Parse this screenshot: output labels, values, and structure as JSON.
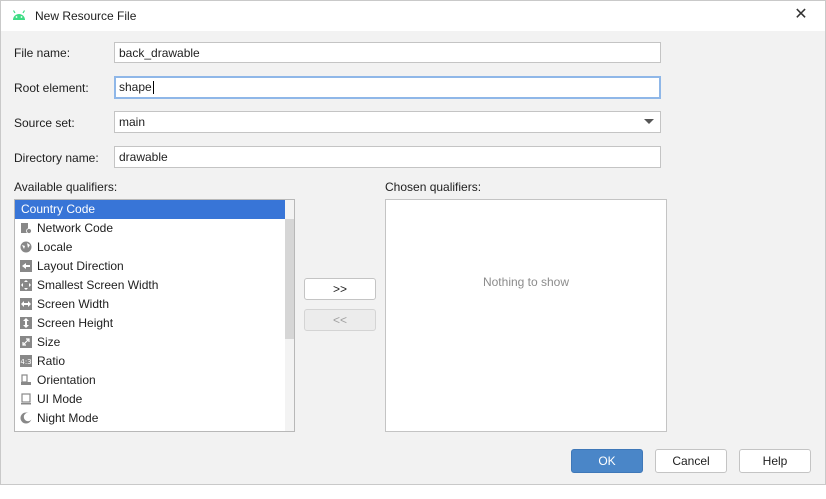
{
  "window": {
    "title": "New Resource File",
    "close_glyph": "✕"
  },
  "form": {
    "file_name_label": "File name:",
    "file_name_value": "back_drawable",
    "root_element_label": "Root element:",
    "root_element_value": "shape",
    "source_set_label": "Source set:",
    "source_set_value": "main",
    "directory_name_label": "Directory name:",
    "directory_name_value": "drawable"
  },
  "qualifiers": {
    "available_label": "Available qualifiers:",
    "chosen_label": "Chosen qualifiers:",
    "chosen_empty": "Nothing to show",
    "items": [
      {
        "label": "Country Code",
        "icon": "country-code-icon",
        "selected": true
      },
      {
        "label": "Network Code",
        "icon": "network-code-icon"
      },
      {
        "label": "Locale",
        "icon": "globe-icon"
      },
      {
        "label": "Layout Direction",
        "icon": "layout-direction-icon"
      },
      {
        "label": "Smallest Screen Width",
        "icon": "smallest-width-icon"
      },
      {
        "label": "Screen Width",
        "icon": "screen-width-icon"
      },
      {
        "label": "Screen Height",
        "icon": "screen-height-icon"
      },
      {
        "label": "Size",
        "icon": "size-icon"
      },
      {
        "label": "Ratio",
        "icon": "ratio-icon"
      },
      {
        "label": "Orientation",
        "icon": "orientation-icon"
      },
      {
        "label": "UI Mode",
        "icon": "ui-mode-icon"
      },
      {
        "label": "Night Mode",
        "icon": "night-mode-icon"
      }
    ],
    "add_label": ">>",
    "remove_label": "<<"
  },
  "buttons": {
    "ok": "OK",
    "cancel": "Cancel",
    "help": "Help"
  },
  "colors": {
    "accent": "#3875d7",
    "primary_button": "#4a86c8",
    "android_green": "#3ddc84"
  }
}
